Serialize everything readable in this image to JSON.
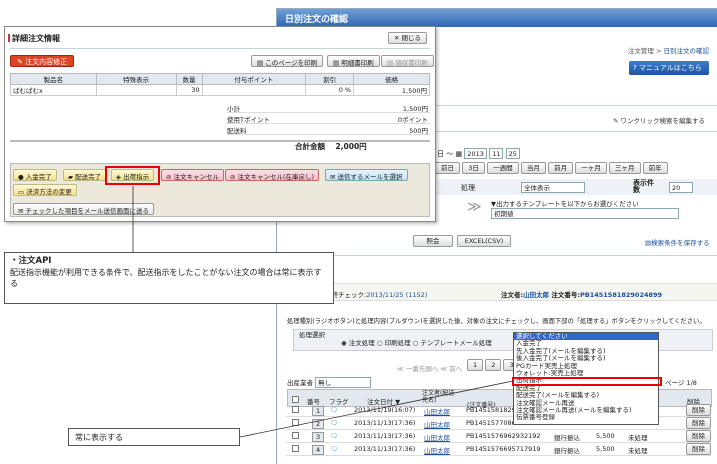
{
  "back": {
    "title": "日別注文の確認",
    "breadcrumb_root": "注文管理 >",
    "breadcrumb_current": "日別注文の確認",
    "manual_btn": "マニュアルはこちら",
    "oneclick": "ワンクリック検索を編集する",
    "date_day": "日",
    "date_year_sel": "2013",
    "date_month_sel": "11",
    "date_dd_sel": "25",
    "range_btns": [
      "前日",
      "3日",
      "一週間",
      "当月",
      "前月",
      "一ヶ月",
      "三ヶ月",
      "前年"
    ],
    "process_label": "処理",
    "process_sel": "全体表示",
    "disp_count_label": "表示件数",
    "disp_count_sel": "20",
    "template_hint": "▼出力するテンプレートを以下からお選びください",
    "template_sel": "初期値",
    "view_btn": "照会",
    "excel_btn": "EXCEL(CSV)",
    "save_cond": "検索条件を保存する",
    "last_check_label": "最終チェック:",
    "last_check_val": "2013/11/25 (1152)",
    "orderer_label": "注文者:",
    "orderer_val": "山田太郎",
    "order_no_label": "注文番号:",
    "order_no_val": "PB1451581829024899",
    "instruction": "処理種別(ラジオボタン)と処理内容(プルダウン)を選択した後、対象の注文にチェックし、画面下部の「処理する」ボタンをクリックしてください。",
    "proc_select_label": "処理選択",
    "radio_opts": [
      "注文処理",
      "印刷処理",
      "テンプレートメール処理"
    ],
    "pager": "≪ 一番先頭へ  ≪ 前へ",
    "pages": [
      "1",
      "2",
      "3"
    ],
    "page_count": "ページ 1/8",
    "shipper_label": "出産業者",
    "shipper_sel": "無し",
    "headers": {
      "no": "番号",
      "flag": "フラグ",
      "date": "注文日付 ▼",
      "orderer": "注文者(配送先名)",
      "order_no": "(注文番号)",
      "del": "削除"
    },
    "rows": [
      {
        "no": "1",
        "date": "2013/11/19(16:07)",
        "name": "山田太郎",
        "order_no": "PB145158182929",
        "pay": "",
        "amt": "",
        "status": "",
        "del": "削除"
      },
      {
        "no": "2",
        "date": "2013/11/13(17:36)",
        "name": "山田太郎",
        "order_no": "PB145157708664",
        "pay": "",
        "amt": "",
        "status": "",
        "del": "削除"
      },
      {
        "no": "3",
        "date": "2013/11/13(17:36)",
        "name": "山田太郎",
        "order_no": "PB1451576962932192",
        "pay": "銀行振込",
        "amt": "5,500",
        "status": "未処理",
        "del": "削除"
      },
      {
        "no": "4",
        "date": "2013/11/13(17:36)",
        "name": "山田太郎",
        "order_no": "PB1451576695717919",
        "pay": "銀行振込",
        "amt": "5,500",
        "status": "未処理",
        "del": "削除"
      }
    ]
  },
  "dropdown": {
    "items": [
      "選択してください",
      "入金完了",
      "先入金完了(メールを編集する)",
      "後入金完了(メールを編集する)",
      "PGカード実売上処理",
      "ウォレット:実売上処理",
      "出荷指示",
      "配送完了",
      "配送完了(メールを編集する)",
      "注文確認メール再送",
      "注文確認メール再送(メールを編集する)",
      "伝票番号登録"
    ]
  },
  "front": {
    "title": "詳細注文情報",
    "close_btn": "閉じる",
    "edit_btn": "注文内容修正",
    "print_page_btn": "このページを印刷",
    "print_stmt_btn": "明細書印刷",
    "print_receipt_btn": "領収書印刷",
    "table_headers": [
      "製品名",
      "特殊表示",
      "数量",
      "付与ポイント",
      "割引",
      "価格"
    ],
    "item_row": [
      "ぱむぱむx",
      "",
      "30",
      "",
      "0 %",
      "1,500円"
    ],
    "subtotal_label": "小計",
    "subtotal_val": "1,500円",
    "points_label": "使用Tポイント",
    "points_val": "0ポイント",
    "shipping_label": "配送料",
    "shipping_val": "500円",
    "total_label": "合計金額",
    "total_val": "2,000円",
    "actions": [
      "入金完了",
      "配送完了",
      "出荷指示",
      "注文キャンセル",
      "注文キャンセル(在庫戻し)",
      "送信するメールを選択",
      "決済方法の変更"
    ],
    "mail_btn": "チェックした項目をメール送信画面に送る"
  },
  "callout1": {
    "heading": "・注文API",
    "body": "配送指示機能が利用できる条件で、配送指示をしたことがない注文の場合は常に表示する"
  },
  "callout2": {
    "text": "常に表示する"
  }
}
